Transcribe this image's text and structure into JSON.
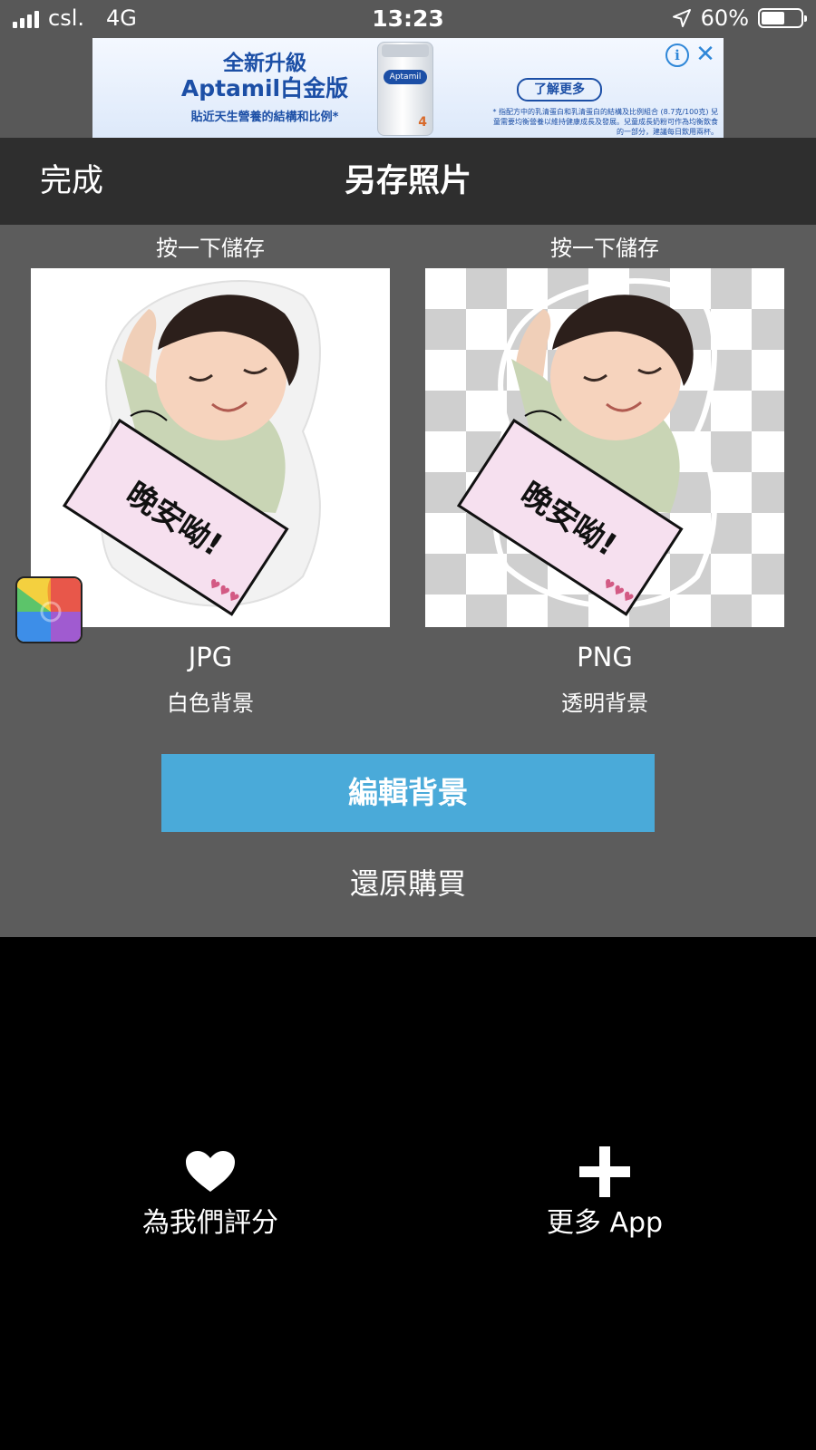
{
  "status_bar": {
    "carrier": "csl.",
    "network": "4G",
    "time": "13:23",
    "battery_percent": "60%",
    "battery_level": 0.6
  },
  "ad": {
    "headline_1": "全新升級",
    "headline_2": "Aptamil白金版",
    "tagline": "貼近天生營養的結構和比例*",
    "product_logo": "Aptamil",
    "product_stage": "4",
    "cta": "了解更多",
    "fine_print": "* 指配方中的乳清蛋白和乳清蛋白的結構及比例組合 (8.7克/100克) 兒童需要均衡營養以維持健康成長及發展。兒童成長奶粉可作為均衡飲食的一部分，建議每日飲用兩杯。",
    "info_icon": "info-icon",
    "close_icon": "close-icon"
  },
  "nav": {
    "done_label": "完成",
    "title": "另存照片"
  },
  "options": [
    {
      "hint": "按一下儲存",
      "format": "JPG",
      "background": "白色背景",
      "sticker_text": "晚安呦!"
    },
    {
      "hint": "按一下儲存",
      "format": "PNG",
      "background": "透明背景",
      "sticker_text": "晚安呦!"
    }
  ],
  "edit_background_label": "編輯背景",
  "restore_purchase_label": "還原購買",
  "bottom_actions": {
    "rate_label": "為我們評分",
    "more_apps_label": "更多 App"
  },
  "colors": {
    "accent_button": "#4aaad9",
    "nav_bar": "#2e2e2e",
    "content_bg": "#5c5c5c"
  }
}
